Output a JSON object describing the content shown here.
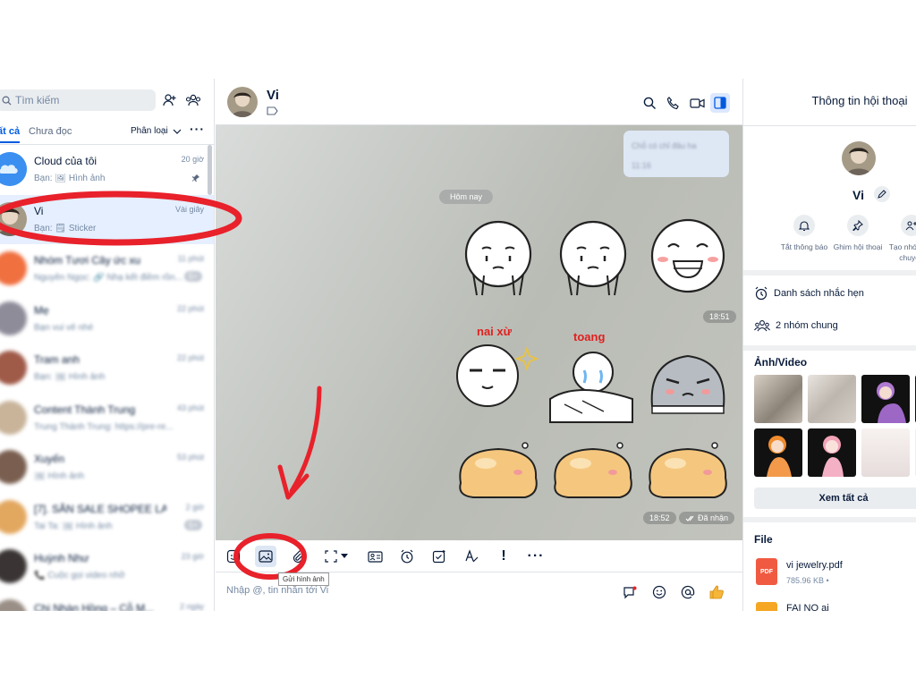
{
  "sidebar": {
    "search_placeholder": "Tìm kiếm",
    "tab_all": "ất cả",
    "tab_unread": "Chưa đọc",
    "classify": "Phân loại",
    "more": "···",
    "conversations": [
      {
        "name": "Cloud của tôi",
        "sub": "Bạn: 🖼 Hình ảnh",
        "time": "20 giờ",
        "pinned": true
      },
      {
        "name": "Vi",
        "sub": "Bạn: 🗒 Sticker",
        "time": "Vài giây",
        "active": true
      },
      {
        "name": "Nhóm Tươi Cây ức xu",
        "sub": "Nguyễn Ngọc: 🔗 Nhạ kết điềm rồn...",
        "time": "11 phút",
        "badge": "5+"
      },
      {
        "name": "Mẹ",
        "sub": "Bạn vui vẻ nhé",
        "time": "22 phút"
      },
      {
        "name": "Tram anh",
        "sub": "Bạn: 🖼 Hình ảnh",
        "time": "22 phút"
      },
      {
        "name": "Content Thành Trung",
        "sub": "Trung Thành Trung: https://pre-re...",
        "time": "43 phút"
      },
      {
        "name": "Xuyến",
        "sub": "🖼 Hình ảnh",
        "time": "53 phút"
      },
      {
        "name": "[7]. SĂN SALE SHOPEE LA...",
        "sub": "Tai Ta: 🖼 Hình ảnh",
        "time": "2 giờ",
        "badge": "5+"
      },
      {
        "name": "Huỳnh Như",
        "sub": "📞 Cuộc gọi video nhỡ",
        "time": "23 giờ"
      },
      {
        "name": "Chị Nhàn Hồng – Cỗ M...",
        "sub": "",
        "time": "2 ngày"
      }
    ]
  },
  "chat": {
    "name": "Vi",
    "sent_line1": "Chỗ có chỉ đâu ha",
    "sent_line2": "11:16",
    "date_separator": "Hôm nay",
    "sticker_time_1": "18:51",
    "sticker_time_2": "18:52",
    "seen_label": "Đã nhận",
    "sticker_text_1": "nai xừ",
    "sticker_text_2": "toang",
    "tooltip": "Gửi hình ảnh",
    "composer_placeholder": "Nhập @, tin nhắn tới Vi"
  },
  "info": {
    "title": "Thông tin hội thoại",
    "name": "Vi",
    "actions": [
      {
        "label": "Tắt thông báo"
      },
      {
        "label": "Ghim hội thoại"
      },
      {
        "label": "Tạo nhóm trò chuyện"
      }
    ],
    "reminders": "Danh sách nhắc hẹn",
    "common_groups": "2 nhóm chung",
    "media_title": "Ảnh/Video",
    "see_all": "Xem tất cả",
    "file_title": "File",
    "file_name": "vi jewelry.pdf",
    "file_size": "785.96 KB •",
    "file_icon_label": "PDF",
    "file2_name": "FAI NO ai"
  },
  "colors": {
    "accent": "#005ae0",
    "annotation": "#e8212b",
    "active_row": "#e5efff"
  }
}
